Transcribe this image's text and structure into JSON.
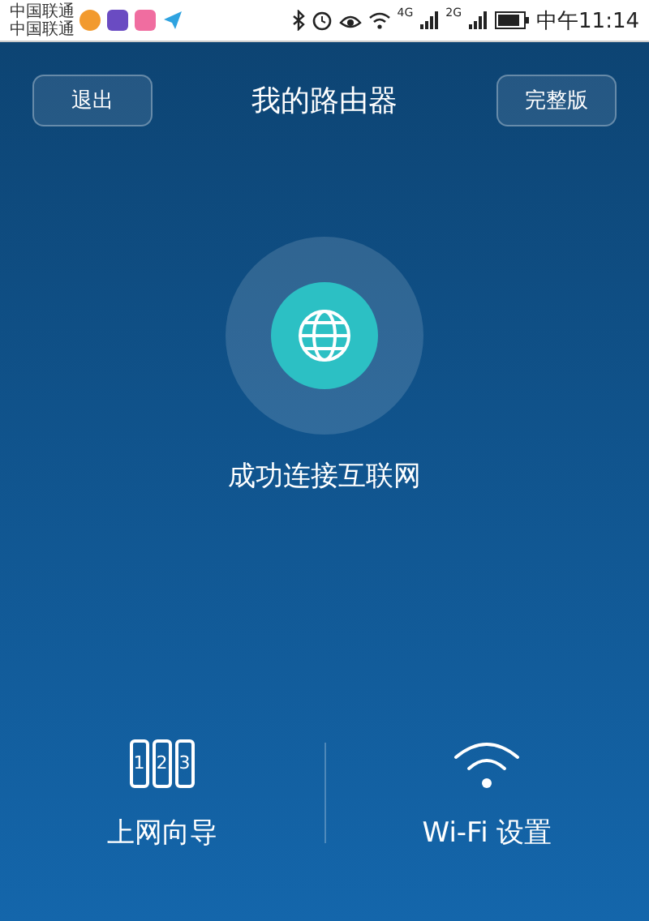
{
  "status_bar": {
    "carriers": [
      "中国联通",
      "中国联通"
    ],
    "network_labels": [
      "4G",
      "2G"
    ],
    "time": "中午11:14"
  },
  "header": {
    "left_button": "退出",
    "title": "我的路由器",
    "right_button": "完整版"
  },
  "status": {
    "text": "成功连接互联网"
  },
  "actions": [
    {
      "kind": "wizard",
      "digits": [
        "1",
        "2",
        "3"
      ],
      "label": "上网向导"
    },
    {
      "kind": "wifi",
      "label": "Wi-Fi 设置"
    }
  ]
}
